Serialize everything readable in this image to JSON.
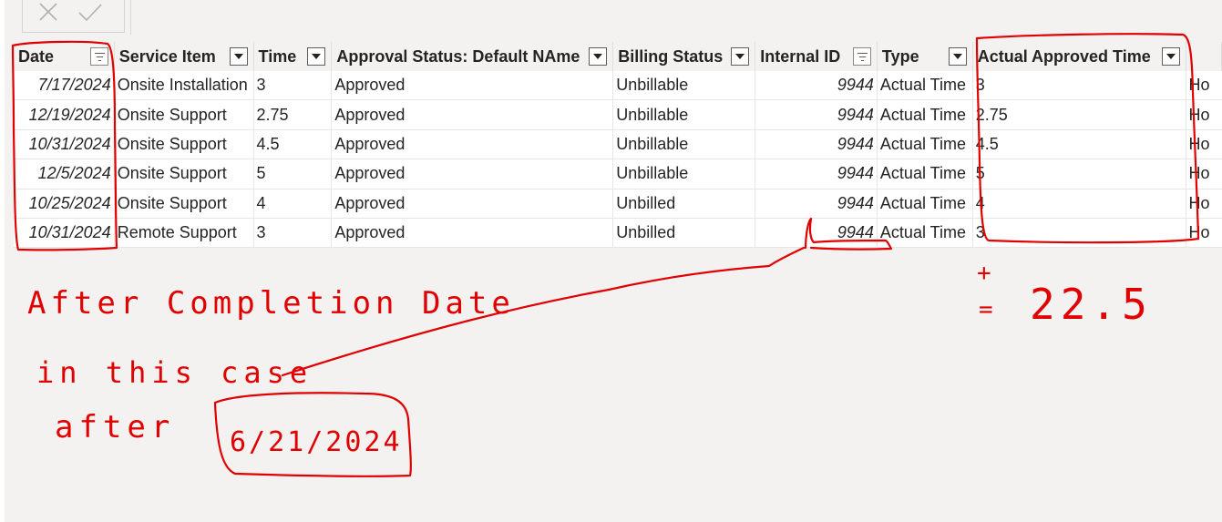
{
  "toolbar": {
    "cancel_icon": "close-icon",
    "apply_icon": "checkmark-icon"
  },
  "table": {
    "columns": [
      {
        "label": "Date",
        "filter": "filter-icon"
      },
      {
        "label": "Service Item",
        "filter": "chevron-down-icon"
      },
      {
        "label": "Time",
        "filter": "chevron-down-icon"
      },
      {
        "label": "Approval Status: Default NAme",
        "filter": "chevron-down-icon"
      },
      {
        "label": "Billing Status",
        "filter": "chevron-down-icon"
      },
      {
        "label": "Internal ID",
        "filter": "filter-icon"
      },
      {
        "label": "Type",
        "filter": "chevron-down-icon"
      },
      {
        "label": "Actual Approved Time",
        "filter": "chevron-down-icon"
      },
      {
        "label": "",
        "filter": ""
      }
    ],
    "rows": [
      [
        "7/17/2024",
        "Onsite Installation",
        "3",
        "Approved",
        "Unbillable",
        "9944",
        "Actual Time",
        "3",
        "Ho"
      ],
      [
        "12/19/2024",
        "Onsite Support",
        "2.75",
        "Approved",
        "Unbillable",
        "9944",
        "Actual Time",
        "2.75",
        "Ho"
      ],
      [
        "10/31/2024",
        "Onsite Support",
        "4.5",
        "Approved",
        "Unbillable",
        "9944",
        "Actual Time",
        "4.5",
        "Ho"
      ],
      [
        "12/5/2024",
        "Onsite Support",
        "5",
        "Approved",
        "Unbillable",
        "9944",
        "Actual Time",
        "5",
        "Ho"
      ],
      [
        "10/25/2024",
        "Onsite Support",
        "4",
        "Approved",
        "Unbilled",
        "9944",
        "Actual Time",
        "4",
        "Ho"
      ],
      [
        "10/31/2024",
        "Remote Support",
        "3",
        "Approved",
        "Unbilled",
        "9944",
        "Actual Time",
        "3",
        "Ho"
      ]
    ]
  },
  "annotations": {
    "line1": "After Completion Date",
    "line2": "in this case",
    "line3_prefix": "after",
    "boxed_date": "6/21/2024",
    "sum_plus": "+",
    "sum_equals": "=",
    "sum_value": "22.5",
    "ink_color": "#e00000"
  }
}
